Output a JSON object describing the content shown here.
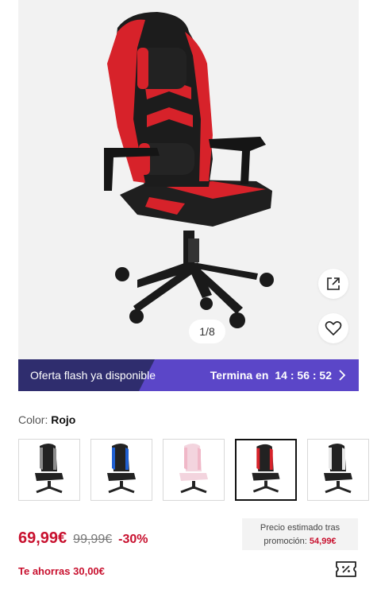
{
  "gallery": {
    "pager": "1/8",
    "share_icon": "external-link-icon",
    "favorite_icon": "heart-icon"
  },
  "flash": {
    "label": "Oferta flash ya disponible",
    "ends_prefix": "Termina en",
    "countdown": "14 : 56 : 52",
    "chevron_icon": "chevron-right-icon"
  },
  "color": {
    "label": "Color:",
    "value": "Rojo",
    "swatches": [
      {
        "name": "grey",
        "accent": "#8c8c8c"
      },
      {
        "name": "blue",
        "accent": "#1f5fd1"
      },
      {
        "name": "pink",
        "accent": "#f0b8c8"
      },
      {
        "name": "red",
        "accent": "#d7222a",
        "selected": true
      },
      {
        "name": "white",
        "accent": "#e8e8e8"
      }
    ]
  },
  "price": {
    "current": "69,99€",
    "original": "99,99€",
    "discount": "-30%",
    "estimate_line1": "Precio estimado tras",
    "estimate_line2": "promoción:",
    "estimate_value": "54,99€",
    "savings": "Te ahorras 30,00€",
    "coupon_icon": "coupon-icon"
  },
  "colors": {
    "accent_red": "#c8102e",
    "flash_purple": "#5b46c8",
    "flash_dark": "#2f2d6e"
  }
}
